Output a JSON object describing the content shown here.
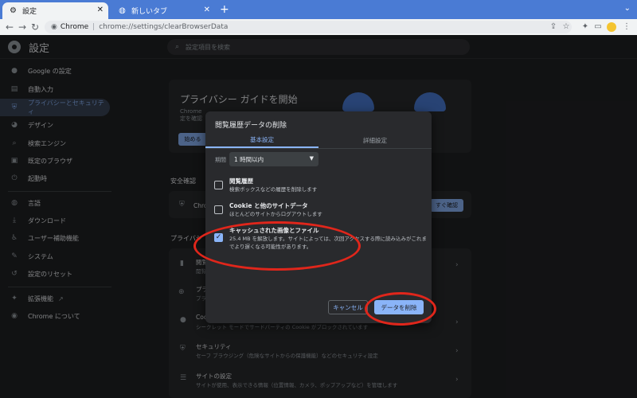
{
  "tabs": [
    {
      "title": "設定",
      "icon": "gear-icon",
      "active": true
    },
    {
      "title": "新しいタブ",
      "icon": "globe-icon",
      "active": false
    }
  ],
  "omnibox": {
    "site": "Chrome",
    "url": "chrome://settings/clearBrowserData"
  },
  "header": {
    "title": "設定",
    "search_placeholder": "設定項目を検索"
  },
  "sidebar": {
    "items": [
      {
        "label": "Google の設定",
        "icon": "person-icon"
      },
      {
        "label": "自動入力",
        "icon": "clipboard-icon"
      },
      {
        "label": "プライバシーとセキュリティ",
        "icon": "shield-icon",
        "active": true
      },
      {
        "label": "デザイン",
        "icon": "palette-icon"
      },
      {
        "label": "検索エンジン",
        "icon": "search-icon"
      },
      {
        "label": "既定のブラウザ",
        "icon": "browser-icon"
      },
      {
        "label": "起動時",
        "icon": "power-icon"
      },
      {
        "label": "言語",
        "icon": "globe-icon"
      },
      {
        "label": "ダウンロード",
        "icon": "download-icon"
      },
      {
        "label": "ユーザー補助機能",
        "icon": "accessibility-icon"
      },
      {
        "label": "システム",
        "icon": "wrench-icon"
      },
      {
        "label": "設定のリセット",
        "icon": "reset-icon"
      },
      {
        "label": "拡張機能",
        "icon": "puzzle-icon"
      },
      {
        "label": "Chrome について",
        "icon": "chrome-icon"
      }
    ]
  },
  "main": {
    "guide_title": "プライバシー ガイドを開始",
    "guide_text_1": "Chrome",
    "guide_text_2": "定を確認",
    "guide_button": "始める",
    "safety_heading": "安全確認",
    "safety_row": "Chrome",
    "check_now": "すぐ確認",
    "privacy_heading": "プライバシ",
    "rows": [
      {
        "title": "閲覧",
        "desc": "閲覧"
      },
      {
        "title": "プラ",
        "desc": "プラ"
      },
      {
        "title": "Coo",
        "desc": "シークレット モードでサードパーティの Cookie がブロックされています"
      },
      {
        "title": "セキュリティ",
        "desc": "セーフ ブラウジング（危険なサイトからの保護機能）などのセキュリティ設定"
      },
      {
        "title": "サイトの設定",
        "desc": "サイトが使用、表示できる情報（位置情報、カメラ、ポップアップなど）を管理します"
      }
    ]
  },
  "dialog": {
    "title": "閲覧履歴データの削除",
    "tab_basic": "基本設定",
    "tab_advanced": "詳細設定",
    "period_label": "期間",
    "period_value": "1 時間以内",
    "options": [
      {
        "title": "閲覧履歴",
        "desc": "検索ボックスなどの履歴を削除します",
        "checked": false
      },
      {
        "title": "Cookie と他のサイトデータ",
        "desc": "ほとんどのサイトからログアウトします",
        "checked": false
      },
      {
        "title": "キャッシュされた画像とファイル",
        "desc": "25.4 MB を解放します。サイトによっては、次回アクセスする際に読み込みがこれまでより遅くなる可能性があります。",
        "checked": true
      }
    ],
    "cancel": "キャンセル",
    "delete": "データを削除"
  },
  "colors": {
    "accent": "#8ab4f8",
    "annotation": "#e0261b",
    "tabbar": "#4a7bd4"
  }
}
